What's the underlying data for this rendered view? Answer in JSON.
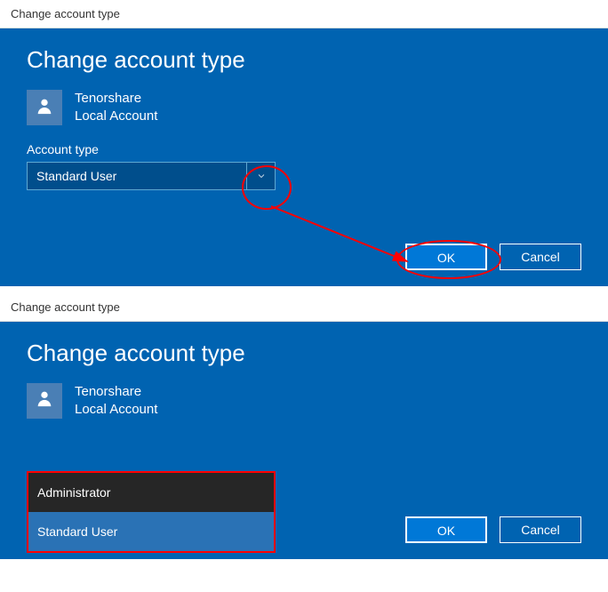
{
  "panel1": {
    "window_title": "Change account type",
    "heading": "Change account type",
    "user_name": "Tenorshare",
    "user_kind": "Local Account",
    "field_label": "Account type",
    "dropdown_value": "Standard User",
    "ok_label": "OK",
    "cancel_label": "Cancel"
  },
  "panel2": {
    "window_title": "Change account type",
    "heading": "Change account type",
    "user_name": "Tenorshare",
    "user_kind": "Local Account",
    "option_admin": "Administrator",
    "option_std": "Standard User",
    "ok_label": "OK",
    "cancel_label": "Cancel"
  }
}
